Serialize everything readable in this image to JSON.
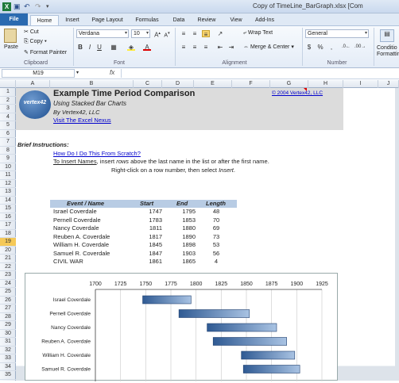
{
  "window": {
    "title": "Copy of TimeLine_BarGraph.xlsx  [Com"
  },
  "tabs": [
    "File",
    "Home",
    "Insert",
    "Page Layout",
    "Formulas",
    "Data",
    "Review",
    "View",
    "Add-Ins"
  ],
  "ribbon": {
    "paste": "Paste",
    "cut": "Cut",
    "copy": "Copy",
    "format_painter": "Format Painter",
    "clipboard": "Clipboard",
    "font_name": "Verdana",
    "font_size": "10",
    "font_group": "Font",
    "wrap_text": "Wrap Text",
    "merge_center": "Merge & Center",
    "alignment_group": "Alignment",
    "number_format": "General",
    "number_group": "Number",
    "cond_format": "Conditio Formattin",
    "currency": "$",
    "percent": "%",
    "comma": ","
  },
  "formula": {
    "namebox": "M19",
    "fx": "fx",
    "value": ""
  },
  "columns": [
    "A",
    "B",
    "C",
    "D",
    "E",
    "F",
    "G",
    "H",
    "I",
    "J"
  ],
  "rows": [
    "1",
    "2",
    "3",
    "4",
    "5",
    "6",
    "7",
    "8",
    "9",
    "10",
    "11",
    "12",
    "13",
    "14",
    "15",
    "16",
    "17",
    "18",
    "19",
    "20",
    "21",
    "22",
    "23",
    "24",
    "25",
    "26",
    "27",
    "28",
    "29",
    "30",
    "31",
    "32",
    "33",
    "34",
    "35"
  ],
  "sheet": {
    "title": "Example Time Period Comparison",
    "subtitle": "Using Stacked Bar Charts",
    "byline": "By Vertex42, LLC",
    "link": "Visit The Excel Nexus",
    "copyright": "© 2004 Vertex42, LLC",
    "logo": "vertex42",
    "instructions_head": "Brief Instructions:",
    "howto": "How Do I Do This From Scratch?",
    "insert_names_link": "To Insert Names",
    "insert_text_a": ", insert ",
    "insert_rows": "rows",
    "insert_text_b": " above the last name in the list or after the first name.",
    "rightclick_a": "Right-click on a row number, then select ",
    "rightclick_insert": "Insert",
    "rightclick_b": "."
  },
  "table": {
    "headers": [
      "Event / Name",
      "Start",
      "End",
      "Length"
    ],
    "rows": [
      [
        "Israel Coverdale",
        "1747",
        "1795",
        "48"
      ],
      [
        "Pernell Coverdale",
        "1783",
        "1853",
        "70"
      ],
      [
        "Nancy Coverdale",
        "1811",
        "1880",
        "69"
      ],
      [
        "Reuben A. Coverdale",
        "1817",
        "1890",
        "73"
      ],
      [
        "William H. Coverdale",
        "1845",
        "1898",
        "53"
      ],
      [
        "Samuel R. Coverdale",
        "1847",
        "1903",
        "56"
      ],
      [
        "CIVIL WAR",
        "1861",
        "1865",
        "4"
      ]
    ]
  },
  "chart_data": {
    "type": "bar",
    "categories": [
      "Israel Coverdale",
      "Pernell Coverdale",
      "Nancy Coverdale",
      "Reuben A. Coverdale",
      "William H. Coverdale",
      "Samuel R. Coverdale"
    ],
    "series": [
      {
        "starts": [
          1747,
          1783,
          1811,
          1817,
          1845,
          1847
        ],
        "ends": [
          1795,
          1853,
          1880,
          1890,
          1898,
          1903
        ]
      }
    ],
    "xlim": [
      1700,
      1925
    ],
    "xticks": [
      "1700",
      "1725",
      "1750",
      "1775",
      "1800",
      "1825",
      "1850",
      "1875",
      "1900",
      "1925"
    ],
    "bar_color": "#4a74a8",
    "grid": true
  }
}
